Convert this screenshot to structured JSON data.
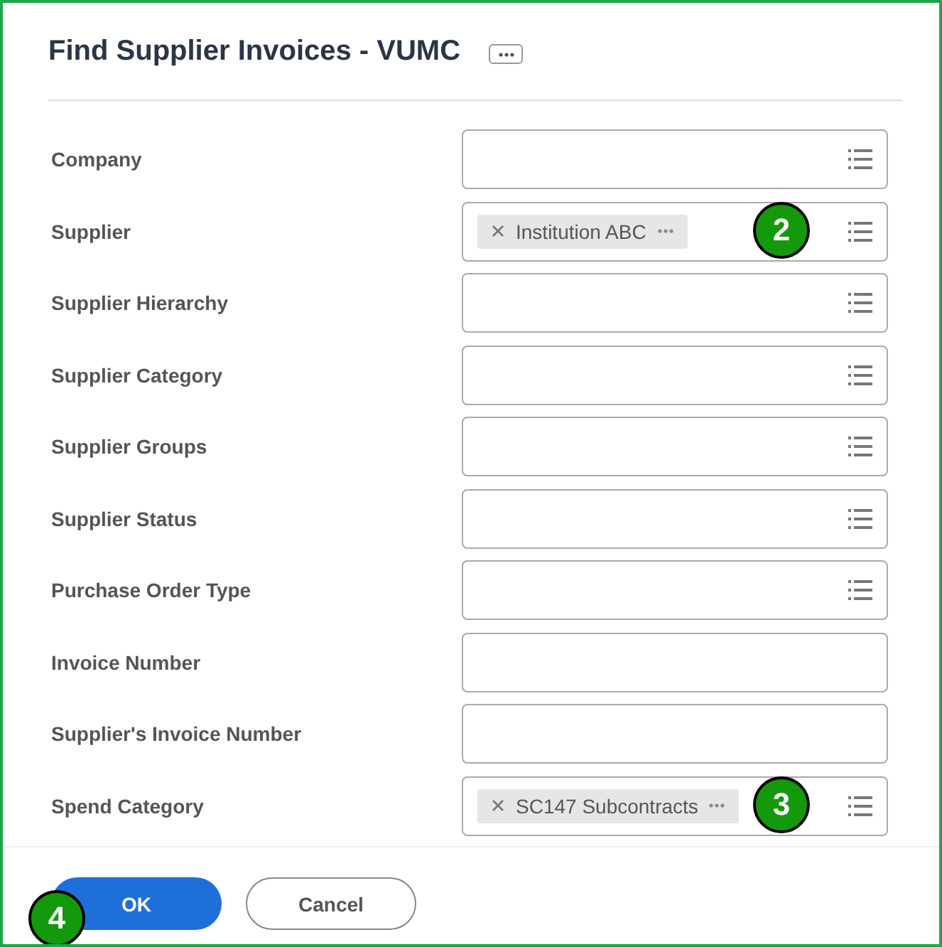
{
  "dialog": {
    "title": "Find Supplier Invoices - VUMC"
  },
  "fields": [
    {
      "label": "Company",
      "kind": "prompt"
    },
    {
      "label": "Supplier",
      "kind": "prompt",
      "chip": "Institution ABC",
      "callout": "2"
    },
    {
      "label": "Supplier Hierarchy",
      "kind": "prompt"
    },
    {
      "label": "Supplier Category",
      "kind": "prompt"
    },
    {
      "label": "Supplier Groups",
      "kind": "prompt"
    },
    {
      "label": "Supplier Status",
      "kind": "prompt"
    },
    {
      "label": "Purchase Order Type",
      "kind": "prompt"
    },
    {
      "label": "Invoice Number",
      "kind": "text"
    },
    {
      "label": "Supplier's Invoice Number",
      "kind": "text"
    },
    {
      "label": "Spend Category",
      "kind": "prompt",
      "chip": "SC147 Subcontracts",
      "callout": "3"
    }
  ],
  "buttons": [
    {
      "label": "OK",
      "kind": "primary"
    },
    {
      "label": "Cancel",
      "kind": "secondary"
    }
  ],
  "footer_callout": "4"
}
